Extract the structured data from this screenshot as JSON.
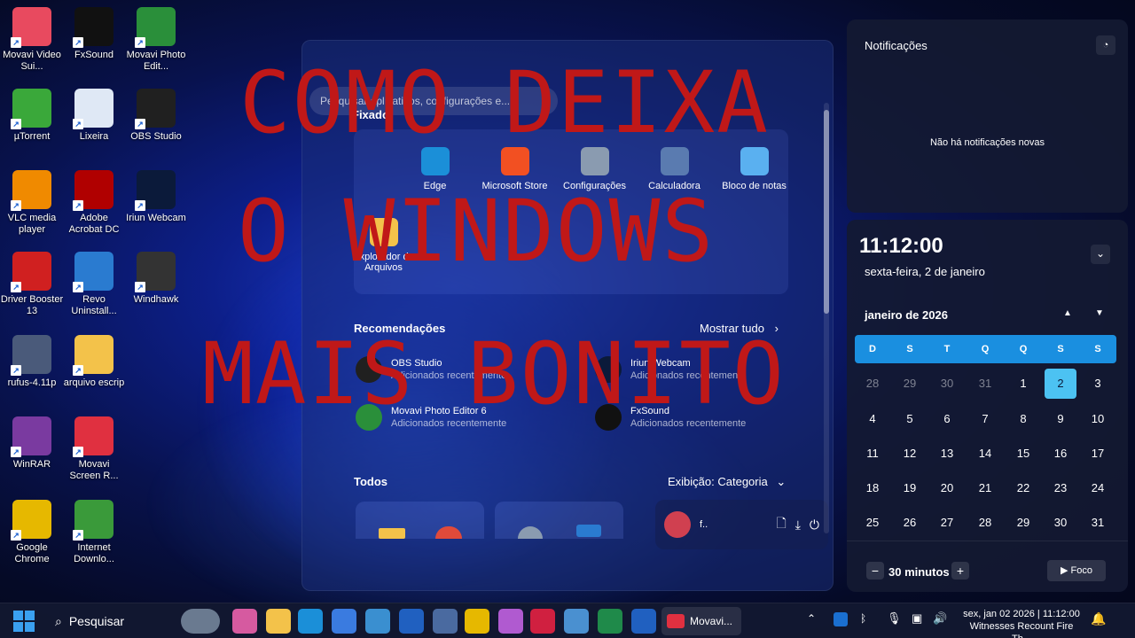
{
  "overlay_text": {
    "line1": "COMO DEIXA",
    "line2": "O WINDOWS",
    "line3": "MAIS BONITO"
  },
  "desktop_icons": [
    {
      "label": "Movavi Video Sui...",
      "color": "#e84a5f"
    },
    {
      "label": "FxSound",
      "color": "#111111"
    },
    {
      "label": "Movavi Photo Edit...",
      "color": "#2a8f3a"
    },
    {
      "label": "µTorrent",
      "color": "#3aa83a"
    },
    {
      "label": "Lixeira",
      "color": "#dfe8f5"
    },
    {
      "label": "OBS Studio",
      "color": "#202020"
    },
    {
      "label": "VLC media player",
      "color": "#f08a00"
    },
    {
      "label": "Adobe Acrobat DC",
      "color": "#b00000"
    },
    {
      "label": "Iriun Webcam",
      "color": "#0b1a3a"
    },
    {
      "label": "Driver Booster 13",
      "color": "#d02020"
    },
    {
      "label": "Revo Uninstall...",
      "color": "#2a7bd0"
    },
    {
      "label": "Windhawk",
      "color": "#333333"
    },
    {
      "label": "rufus-4.11p",
      "color": "#4a5a7a"
    },
    {
      "label": "arquivo escrip",
      "color": "#f3c24a"
    },
    {
      "label": "WinRAR",
      "color": "#7a3aa0"
    },
    {
      "label": "Movavi Screen R...",
      "color": "#e03040"
    },
    {
      "label": "Google Chrome",
      "color": "#e6b800"
    },
    {
      "label": "Internet Downlo...",
      "color": "#3a9a3a"
    }
  ],
  "start_menu": {
    "search_placeholder": "Pesquisar aplicativos, configurações e...",
    "pinned_title": "Fixado",
    "pinned": [
      {
        "label": "Edge",
        "color": "#1b8fd8"
      },
      {
        "label": "Microsoft Store",
        "color": "#f25022"
      },
      {
        "label": "Configurações",
        "color": "#8a9bb0"
      },
      {
        "label": "Calculadora",
        "color": "#5a7bb0"
      },
      {
        "label": "Bloco de notas",
        "color": "#5ab0f0"
      },
      {
        "label": "Explorador de Arquivos",
        "color": "#f3c24a"
      }
    ],
    "recommendations_title": "Recomendações",
    "show_all": "Mostrar tudo",
    "recommendations": [
      {
        "title": "OBS Studio",
        "subtitle": "Adicionados recentemente",
        "color": "#202020"
      },
      {
        "title": "Iriun Webcam",
        "subtitle": "Adicionados recentemente",
        "color": "#0b1a3a"
      },
      {
        "title": "Movavi Photo Editor 6",
        "subtitle": "Adicionados recentemente",
        "color": "#2a8f3a"
      },
      {
        "title": "FxSound",
        "subtitle": "Adicionados recentemente",
        "color": "#111111"
      }
    ],
    "all_title": "Todos",
    "view_label": "Exibição: Categoria",
    "user_name": "f.."
  },
  "notifications": {
    "title": "Notificações",
    "empty_text": "Não há notificações novas"
  },
  "calendar": {
    "time": "11:12:00",
    "date": "sexta-feira, 2 de janeiro",
    "month": "janeiro de 2026",
    "weekdays": [
      "D",
      "S",
      "T",
      "Q",
      "Q",
      "S",
      "S"
    ],
    "weeks": [
      [
        "28",
        "29",
        "30",
        "31",
        "1",
        "2",
        "3"
      ],
      [
        "4",
        "5",
        "6",
        "7",
        "8",
        "9",
        "10"
      ],
      [
        "11",
        "12",
        "13",
        "14",
        "15",
        "16",
        "17"
      ],
      [
        "18",
        "19",
        "20",
        "21",
        "22",
        "23",
        "24"
      ],
      [
        "25",
        "26",
        "27",
        "28",
        "29",
        "30",
        "31"
      ]
    ],
    "selected_day": "2",
    "focus_minutes": "30 minutos",
    "focus_button": "Foco"
  },
  "taskbar": {
    "search_label": "Pesquisar",
    "active_app": "Movavi...",
    "clock": "sex, jan 02 2026 | 11:12:00",
    "news": "Witnesses Recount Fire Th..."
  }
}
